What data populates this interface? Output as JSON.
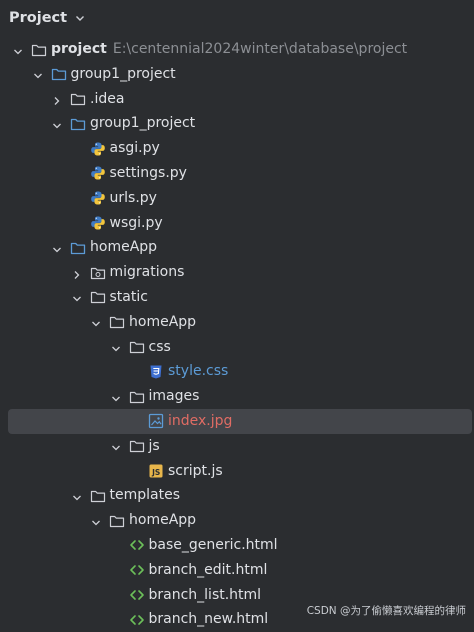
{
  "panel": {
    "title": "Project"
  },
  "tree": [
    {
      "depth": 0,
      "expander": "open",
      "icon": "folder-icon",
      "label": "project",
      "path": "E:\\centennial2024winter\\database\\project",
      "style": "bold"
    },
    {
      "depth": 1,
      "expander": "open",
      "icon": "module-folder-icon",
      "label": "group1_project"
    },
    {
      "depth": 2,
      "expander": "closed",
      "icon": "folder-icon",
      "label": ".idea"
    },
    {
      "depth": 2,
      "expander": "open",
      "icon": "package-folder-icon",
      "label": "group1_project"
    },
    {
      "depth": 3,
      "expander": "none",
      "icon": "python-file-icon",
      "label": "asgi.py"
    },
    {
      "depth": 3,
      "expander": "none",
      "icon": "python-file-icon",
      "label": "settings.py"
    },
    {
      "depth": 3,
      "expander": "none",
      "icon": "python-file-icon",
      "label": "urls.py"
    },
    {
      "depth": 3,
      "expander": "none",
      "icon": "python-file-icon",
      "label": "wsgi.py"
    },
    {
      "depth": 2,
      "expander": "open",
      "icon": "package-folder-icon",
      "label": "homeApp"
    },
    {
      "depth": 3,
      "expander": "closed",
      "icon": "migrations-folder-icon",
      "label": "migrations"
    },
    {
      "depth": 3,
      "expander": "open",
      "icon": "folder-icon",
      "label": "static"
    },
    {
      "depth": 4,
      "expander": "open",
      "icon": "folder-icon",
      "label": "homeApp"
    },
    {
      "depth": 5,
      "expander": "open",
      "icon": "folder-icon",
      "label": "css"
    },
    {
      "depth": 6,
      "expander": "none",
      "icon": "css-file-icon",
      "label": "style.css",
      "style": "blue"
    },
    {
      "depth": 5,
      "expander": "open",
      "icon": "folder-icon",
      "label": "images"
    },
    {
      "depth": 6,
      "expander": "none",
      "icon": "image-file-icon",
      "label": "index.jpg",
      "style": "red",
      "selected": true
    },
    {
      "depth": 5,
      "expander": "open",
      "icon": "folder-icon",
      "label": "js"
    },
    {
      "depth": 6,
      "expander": "none",
      "icon": "js-file-icon",
      "label": "script.js"
    },
    {
      "depth": 3,
      "expander": "open",
      "icon": "folder-icon",
      "label": "templates"
    },
    {
      "depth": 4,
      "expander": "open",
      "icon": "folder-icon",
      "label": "homeApp"
    },
    {
      "depth": 5,
      "expander": "none",
      "icon": "html-file-icon",
      "label": "base_generic.html"
    },
    {
      "depth": 5,
      "expander": "none",
      "icon": "html-file-icon",
      "label": "branch_edit.html"
    },
    {
      "depth": 5,
      "expander": "none",
      "icon": "html-file-icon",
      "label": "branch_list.html"
    },
    {
      "depth": 5,
      "expander": "none",
      "icon": "html-file-icon",
      "label": "branch_new.html"
    }
  ],
  "watermark": "CSDN @为了偷懒喜欢编程的律师",
  "colors": {
    "background": "#2b2d30",
    "text": "#dfe1e5",
    "path_text": "#8c8f94",
    "selection": "#43454a",
    "css_label": "#5c9bd6",
    "image_label": "#e06c64",
    "folder_stroke": "#ced0d6",
    "module_folder_stroke": "#5c9bd6"
  }
}
